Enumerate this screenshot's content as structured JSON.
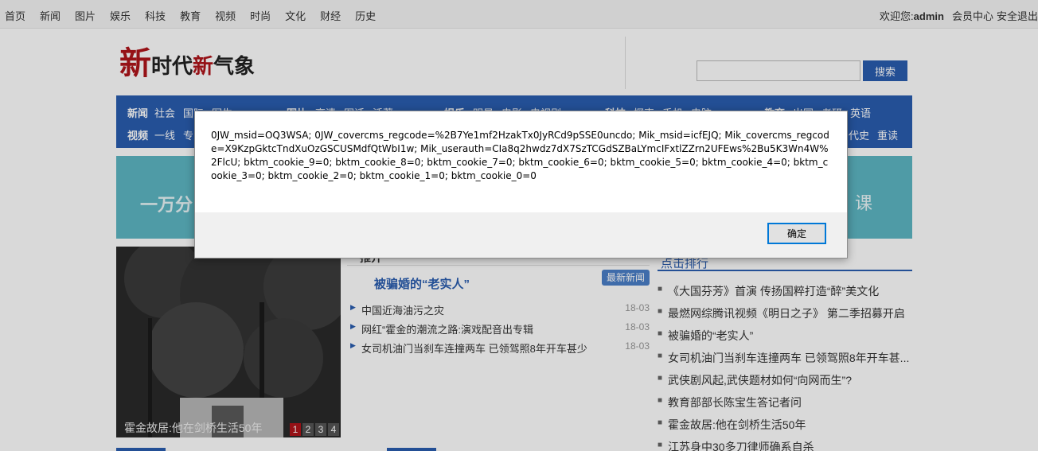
{
  "topbar": {
    "nav": [
      "首页",
      "新闻",
      "图片",
      "娱乐",
      "科技",
      "教育",
      "视频",
      "时尚",
      "文化",
      "财经",
      "历史"
    ],
    "welcome_prefix": "欢迎您:",
    "username": "admin",
    "member_center": "会员中心",
    "logout": "安全退出"
  },
  "header": {
    "logo_char1": "新",
    "logo_mid": "时代",
    "logo_char2": "新",
    "logo_end": "气象",
    "search_button": "搜索"
  },
  "mainnav": {
    "news_row": [
      "新闻",
      "社会",
      "国际",
      "军生"
    ],
    "video_row": [
      "视频",
      "一线",
      "专"
    ],
    "pic_row": [
      "图片",
      "高清",
      "图话",
      "活著"
    ],
    "ent_row": [
      "娱乐",
      "明星",
      "电影",
      "电视剧"
    ],
    "tech_row": [
      "科技",
      "探索",
      "手机",
      "电脑"
    ],
    "edu_row": [
      "教育",
      "出国",
      "考研",
      "英语"
    ],
    "right_row2": [
      "代史",
      "重读"
    ]
  },
  "banner": {
    "left_text": "一万分",
    "right_text": "课"
  },
  "slideshow": {
    "caption": "霍金故居:他在剑桥生活50年",
    "pages": [
      "1",
      "2",
      "3",
      "4"
    ]
  },
  "middle": {
    "section_title": "推介",
    "headline": "被骗婚的“老实人”",
    "latest_button": "最新新闻",
    "news": [
      {
        "title": "中国近海油污之灾",
        "date": "18-03"
      },
      {
        "title": "网红“霍金的潮流之路:演戏配音出专辑",
        "date": "18-03"
      },
      {
        "title": "女司机油门当刹车连撞两车 已领驾照8年开车甚少",
        "date": "18-03"
      }
    ]
  },
  "ranking": {
    "title": "点击排行",
    "items": [
      "《大国芬芳》首演 传扬国粹打造“醉”美文化",
      "最燃网综腾讯视频《明日之子》 第二季招募开启",
      "被骗婚的“老实人”",
      "女司机油门当刹车连撞两车 已领驾照8年开车甚...",
      "武侠剧风起,武侠题材如何“向网而生”?",
      "教育部部长陈宝生答记者问",
      "霍金故居:他在剑桥生活50年",
      "江苏身中30多刀律师确系自杀"
    ]
  },
  "dialog": {
    "message": "0JW_msid=OQ3WSA; 0JW_covercms_regcode=%2B7Ye1mf2HzakTx0JyRCd9pSSE0uncdo; Mik_msid=icfEJQ; Mik_covercms_regcode=X9KzpGktcTndXuOzGSCUSMdfQtWbI1w; Mik_userauth=CIa8q2hwdz7dX7SzTCGdSZBaLYmcIFxtlZZrn2UFEws%2Bu5K3Wn4W%2FlcU; bktm_cookie_9=0; bktm_cookie_8=0; bktm_cookie_7=0; bktm_cookie_6=0; bktm_cookie_5=0; bktm_cookie_4=0; bktm_cookie_3=0; bktm_cookie_2=0; bktm_cookie_1=0; bktm_cookie_0=0",
    "ok_button": "确定"
  },
  "colors": {
    "brand_blue": "#2a5db0",
    "brand_red": "#b0141a",
    "banner": "#5db7c4",
    "dialog_focus": "#0078d7"
  }
}
